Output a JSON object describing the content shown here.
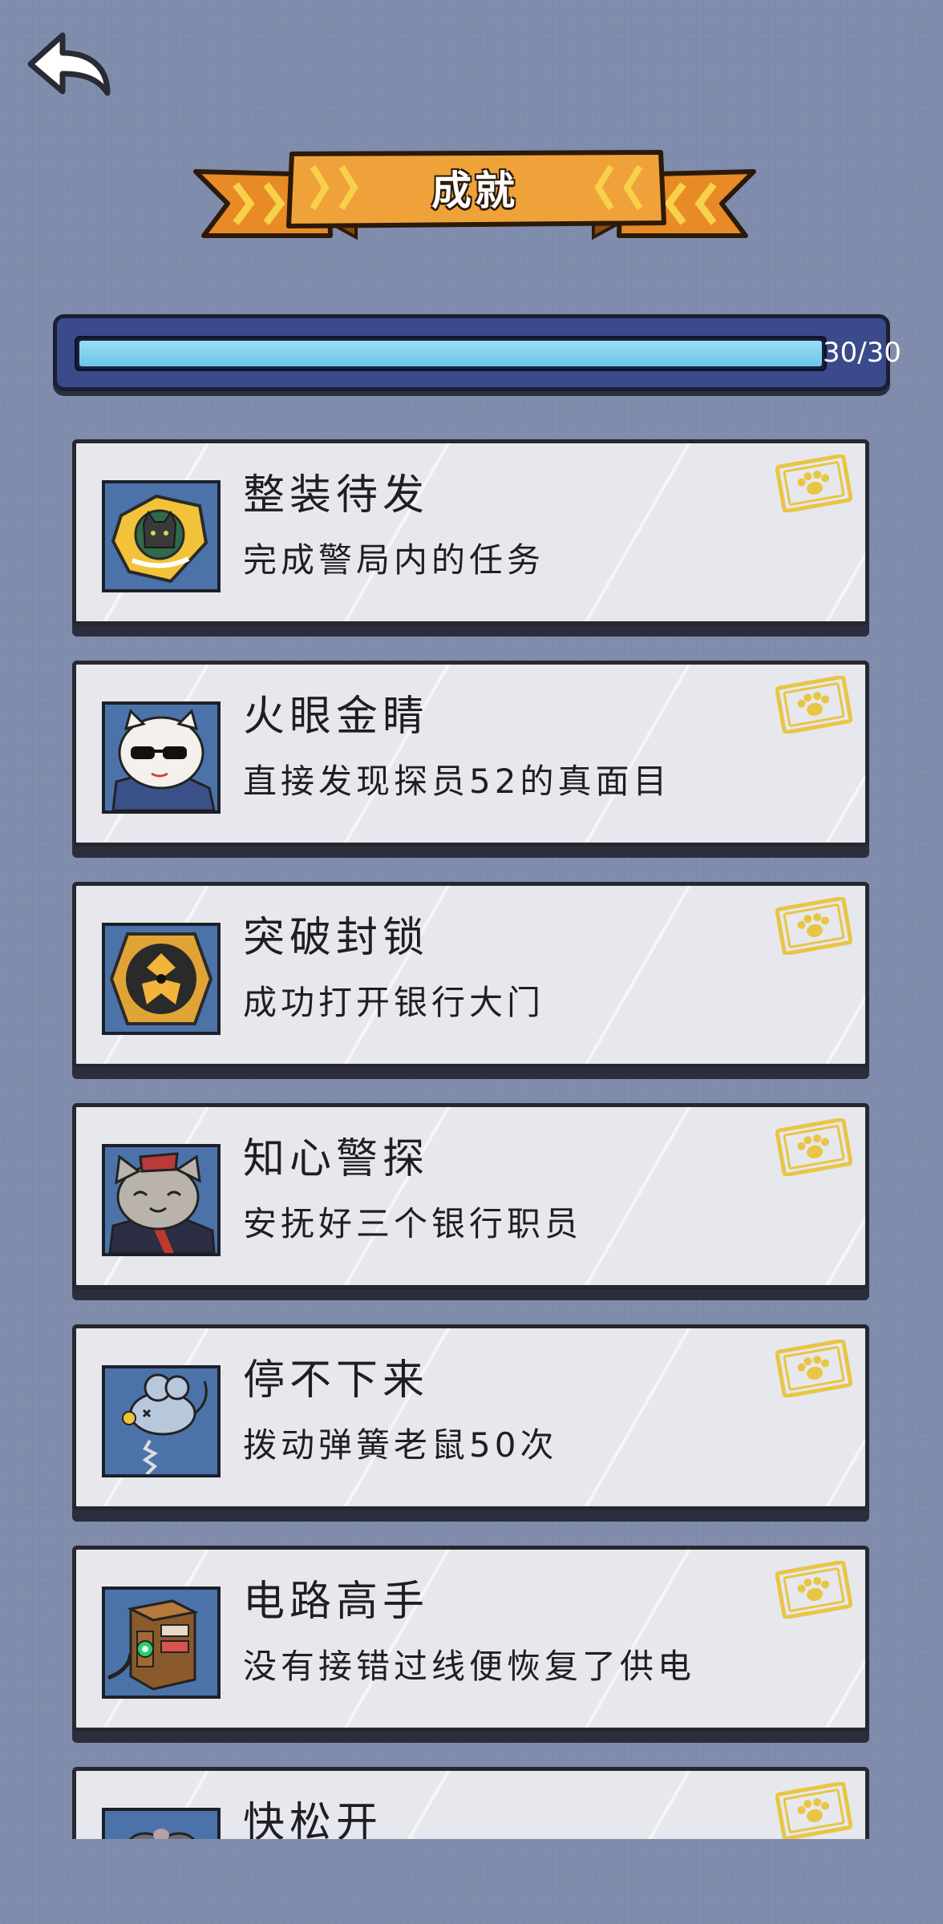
{
  "header": {
    "title": "成就",
    "back_icon": "back-arrow-icon"
  },
  "progress": {
    "text": "30/30",
    "completed": 30,
    "total": 30,
    "fraction": 1.0
  },
  "colors": {
    "background": "#7f8cab",
    "banner_orange": "#f0a23a",
    "progress_fill": "#7fcfef",
    "card": "#e7e8ed",
    "stamp_gold": "#e8c544"
  },
  "achievements": [
    {
      "title": "整装待发",
      "description": "完成警局内的任务",
      "icon": "police-badge-cat-icon",
      "completed": true
    },
    {
      "title": "火眼金睛",
      "description": "直接发现探员52的真面目",
      "icon": "sunglasses-cat-icon",
      "completed": true
    },
    {
      "title": "突破封锁",
      "description": "成功打开银行大门",
      "icon": "vault-lock-icon",
      "completed": true
    },
    {
      "title": "知心警探",
      "description": "安抚好三个银行职员",
      "icon": "smiling-cat-clerk-icon",
      "completed": true
    },
    {
      "title": "停不下来",
      "description": "拨动弹簧老鼠50次",
      "icon": "spring-mouse-toy-icon",
      "completed": true
    },
    {
      "title": "电路高手",
      "description": "没有接错过线便恢复了供电",
      "icon": "electric-box-icon",
      "completed": true
    },
    {
      "title": "快松开",
      "description": "",
      "icon": "cat-paw-icon",
      "completed": true
    }
  ]
}
